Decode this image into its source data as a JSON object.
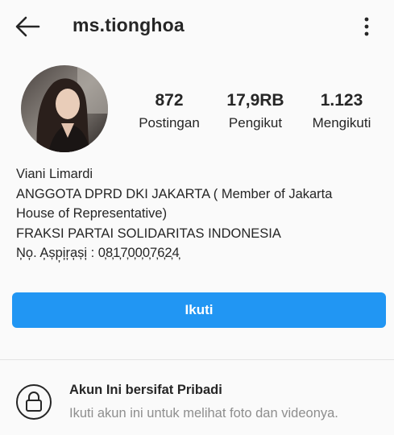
{
  "header": {
    "username": "ms.tionghoa",
    "back_icon": "arrow-left-icon",
    "menu_icon": "more-vertical-icon"
  },
  "profile": {
    "avatar_icon": "profile-photo"
  },
  "stats": {
    "posts_count": "872",
    "posts_label": "Postingan",
    "followers_count": "17,9RB",
    "followers_label": "Pengikut",
    "following_count": "1.123",
    "following_label": "Mengikuti"
  },
  "bio": {
    "name": "Viani Limardi",
    "line1": "ANGGOTA DPRD DKI JAKARTA ( Member of Jakarta",
    "line2": "House of Representative)",
    "line3": "FRAKSI PARTAI SOLIDARITAS INDONESIA",
    "line4": "N̦o̦. A̦șp̦i̦r̦a̦și̦ : 0̦8̦1̦7̦0̦0̦0̦7̦6̦2̦4̦"
  },
  "actions": {
    "follow_label": "Ikuti",
    "follow_color": "#2196f3"
  },
  "private_notice": {
    "lock_icon": "lock-icon",
    "title": "Akun Ini bersifat Pribadi",
    "subtitle": "Ikuti akun ini untuk melihat foto dan videonya."
  }
}
